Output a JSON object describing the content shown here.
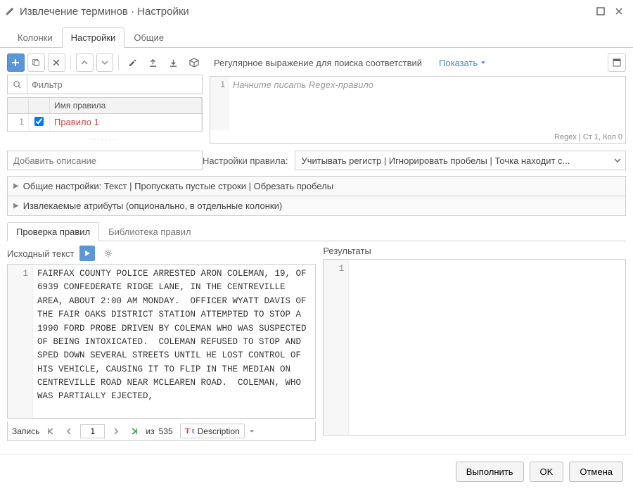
{
  "window": {
    "title": "Извлечение терминов · Настройки"
  },
  "tabs": {
    "columns": "Колонки",
    "settings": "Настройки",
    "general": "Общие"
  },
  "rules_toolbar": {
    "regex_label": "Регулярное выражение для поиска соответствий",
    "show_label": "Показать"
  },
  "filter": {
    "placeholder": "Фильтр"
  },
  "rules_table": {
    "header_name": "Имя правила",
    "rows": [
      {
        "num": "1",
        "checked": true,
        "name": "Правило 1"
      }
    ]
  },
  "editor": {
    "gutter_line": "1",
    "placeholder": "Начните писать Regex-правило",
    "status_lang": "Regex",
    "status_pos": "Ст 1, Кол 0"
  },
  "description": {
    "placeholder": "Добавить описание"
  },
  "rule_settings": {
    "label": "Настройки правила:",
    "value": "Учитывать регистр | Игнорировать пробелы | Точка находит с..."
  },
  "collapsers": {
    "c1": "Общие настройки: Текст | Пропускать пустые строки | Обрезать пробелы",
    "c2": "Извлекаемые атрибуты (опционально, в отдельные колонки)"
  },
  "subtabs": {
    "check": "Проверка правил",
    "library": "Библиотека правил"
  },
  "source": {
    "title": "Исходный текст",
    "gutter": "1",
    "text": "FAIRFAX COUNTY POLICE ARRESTED ARON COLEMAN, 19, OF 6939 CONFEDERATE RIDGE LANE, IN THE CENTREVILLE AREA, ABOUT 2:00 AM MONDAY.  OFFICER WYATT DAVIS OF THE FAIR OAKS DISTRICT STATION ATTEMPTED TO STOP A 1990 FORD PROBE DRIVEN BY COLEMAN WHO WAS SUSPECTED OF BEING INTOXICATED.  COLEMAN REFUSED TO STOP AND SPED DOWN SEVERAL STREETS UNTIL HE LOST CONTROL OF HIS VEHICLE, CAUSING IT TO FLIP IN THE MEDIAN ON CENTREVILLE ROAD NEAR MCLEAREN ROAD.  COLEMAN, WHO WAS PARTIALLY EJECTED,"
  },
  "results": {
    "title": "Результаты",
    "gutter": "1"
  },
  "nav": {
    "label": "Запись",
    "page": "1",
    "of_label": "из",
    "total": "535",
    "column": "Description"
  },
  "footer": {
    "run": "Выполнить",
    "ok": "OK",
    "cancel": "Отмена"
  }
}
